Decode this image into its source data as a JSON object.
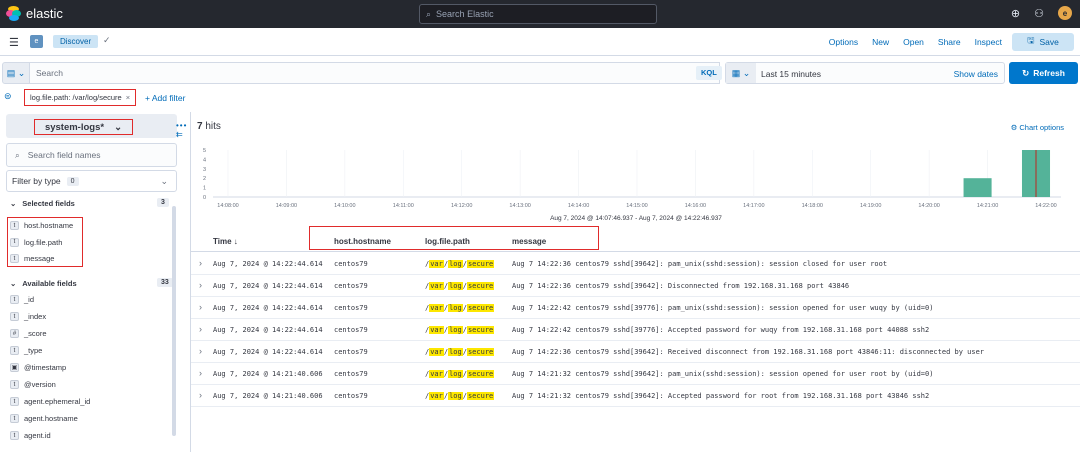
{
  "topbar": {
    "brand": "elastic",
    "search_placeholder": "Search Elastic",
    "avatar": "e",
    "icons": [
      "help-icon",
      "newsfeed-icon"
    ]
  },
  "appbar": {
    "space": "e",
    "breadcrumb": "Discover",
    "menu": [
      "Options",
      "New",
      "Open",
      "Share",
      "Inspect"
    ],
    "save": "Save"
  },
  "query": {
    "placeholder": "Search",
    "language": "KQL",
    "time": "Last 15 minutes",
    "show_dates": "Show dates",
    "refresh": "Refresh"
  },
  "filters": {
    "pill": "log.file.path: /var/log/secure",
    "add": "+ Add filter"
  },
  "sidebar": {
    "index_pattern": "system-logs*",
    "field_search_placeholder": "Search field names",
    "filter_by_type": "Filter by type",
    "filter_count": "0",
    "selected_title": "Selected fields",
    "selected_count": "3",
    "selected": [
      {
        "type": "t",
        "name": "host.hostname"
      },
      {
        "type": "t",
        "name": "log.file.path"
      },
      {
        "type": "t",
        "name": "message"
      }
    ],
    "available_title": "Available fields",
    "available_count": "33",
    "available": [
      {
        "type": "t",
        "name": "_id"
      },
      {
        "type": "t",
        "name": "_index"
      },
      {
        "type": "#",
        "name": "_score"
      },
      {
        "type": "t",
        "name": "_type"
      },
      {
        "type": "▣",
        "name": "@timestamp"
      },
      {
        "type": "t",
        "name": "@version"
      },
      {
        "type": "t",
        "name": "agent.ephemeral_id"
      },
      {
        "type": "t",
        "name": "agent.hostname"
      },
      {
        "type": "t",
        "name": "agent.id"
      }
    ]
  },
  "main": {
    "hits_count": "7",
    "hits_label": "hits",
    "chart_options": "Chart options",
    "time_range": "Aug 7, 2024 @ 14:07:46.937 - Aug 7, 2024 @ 14:22:46.937"
  },
  "chart_data": {
    "type": "bar",
    "x_ticks": [
      "14:08:00",
      "14:09:00",
      "14:10:00",
      "14:11:00",
      "14:12:00",
      "14:13:00",
      "14:14:00",
      "14:15:00",
      "14:16:00",
      "14:17:00",
      "14:18:00",
      "14:19:00",
      "14:20:00",
      "14:21:00",
      "14:22:00"
    ],
    "y_ticks": [
      0,
      1,
      2,
      3,
      4,
      5
    ],
    "ylim": [
      0,
      5
    ],
    "bars": [
      {
        "x": "14:21:00",
        "value": 2
      },
      {
        "x": "14:22:00",
        "value": 5
      }
    ],
    "bar_color": "#54b399",
    "now_marker_color": "#bd271e"
  },
  "table": {
    "columns": [
      "Time ↓",
      "host.hostname",
      "log.file.path",
      "message"
    ],
    "rows": [
      {
        "time": "Aug 7, 2024 @ 14:22:44.614",
        "host": "centos79",
        "message": "Aug  7 14:22:36 centos79 sshd[39642]: pam_unix(sshd:session): session closed for user root"
      },
      {
        "time": "Aug 7, 2024 @ 14:22:44.614",
        "host": "centos79",
        "message": "Aug  7 14:22:36 centos79 sshd[39642]: Disconnected from 192.168.31.168 port 43846"
      },
      {
        "time": "Aug 7, 2024 @ 14:22:44.614",
        "host": "centos79",
        "message": "Aug  7 14:22:42 centos79 sshd[39776]: pam_unix(sshd:session): session opened for user wuqy by (uid=0)"
      },
      {
        "time": "Aug 7, 2024 @ 14:22:44.614",
        "host": "centos79",
        "message": "Aug  7 14:22:42 centos79 sshd[39776]: Accepted password for wuqy from 192.168.31.168 port 44088 ssh2"
      },
      {
        "time": "Aug 7, 2024 @ 14:22:44.614",
        "host": "centos79",
        "message": "Aug  7 14:22:36 centos79 sshd[39642]: Received disconnect from 192.168.31.168 port 43846:11: disconnected by user"
      },
      {
        "time": "Aug 7, 2024 @ 14:21:40.606",
        "host": "centos79",
        "message": "Aug  7 14:21:32 centos79 sshd[39642]: pam_unix(sshd:session): session opened for user root by (uid=0)"
      },
      {
        "time": "Aug 7, 2024 @ 14:21:40.606",
        "host": "centos79",
        "message": "Aug  7 14:21:32 centos79 sshd[39642]: Accepted password for root from 192.168.31.168 port 43846 ssh2"
      }
    ],
    "path_parts": [
      "/",
      "var",
      "/",
      "log",
      "/",
      "secure"
    ]
  }
}
